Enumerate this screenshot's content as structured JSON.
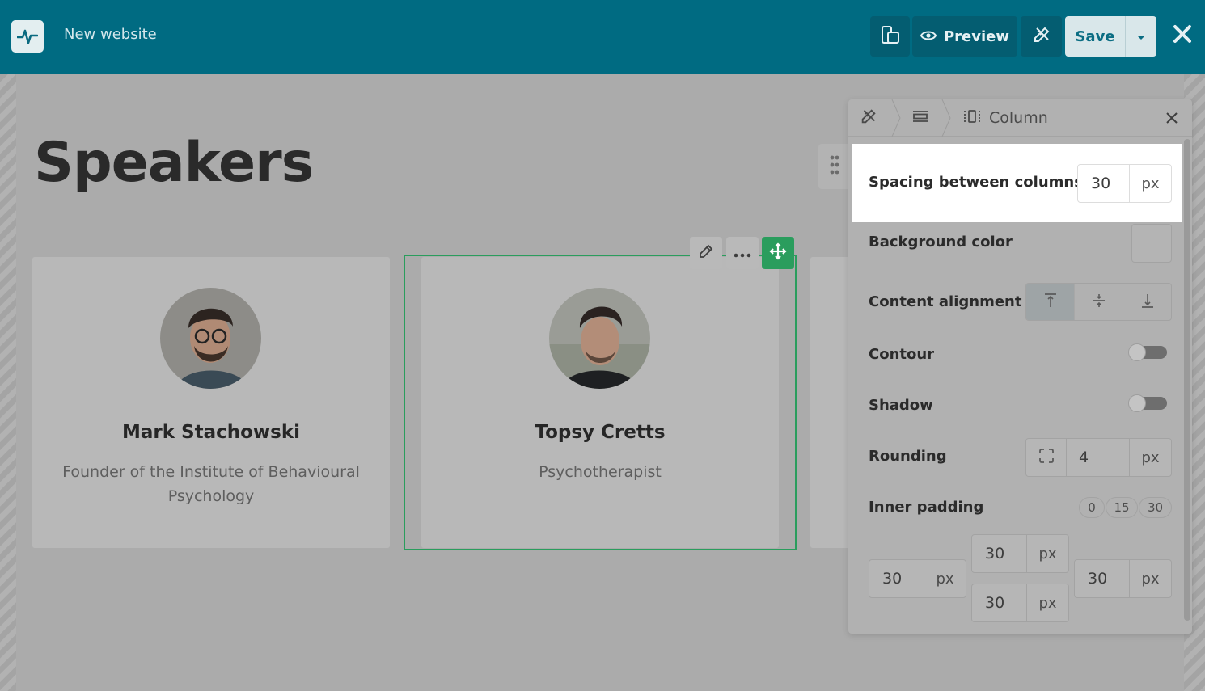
{
  "topbar": {
    "site_title": "New website",
    "preview_label": "Preview",
    "save_label": "Save"
  },
  "page": {
    "heading": "Speakers"
  },
  "cards": [
    {
      "name": "Mark Stachowski",
      "role": "Founder of the Institute of Behavioural Psychology"
    },
    {
      "name": "Topsy Cretts",
      "role": "Psychotherapist"
    }
  ],
  "panel": {
    "breadcrumb_current": "Column",
    "spacing": {
      "label": "Spacing between columns",
      "value": "30",
      "unit": "px"
    },
    "background": {
      "label": "Background color"
    },
    "alignment": {
      "label": "Content alignment",
      "options": [
        "top",
        "center",
        "bottom"
      ],
      "selected": "top"
    },
    "contour": {
      "label": "Contour",
      "on": false
    },
    "shadow": {
      "label": "Shadow",
      "on": false
    },
    "rounding": {
      "label": "Rounding",
      "value": "4",
      "unit": "px"
    },
    "inner_padding": {
      "label": "Inner padding",
      "presets": [
        "0",
        "15",
        "30"
      ],
      "top": "30",
      "left": "30",
      "right": "30",
      "bottom": "30",
      "unit": "px"
    }
  },
  "colors": {
    "topbar": "#006b82",
    "selection": "#2a9d5d",
    "save_text": "#0b6d83"
  }
}
